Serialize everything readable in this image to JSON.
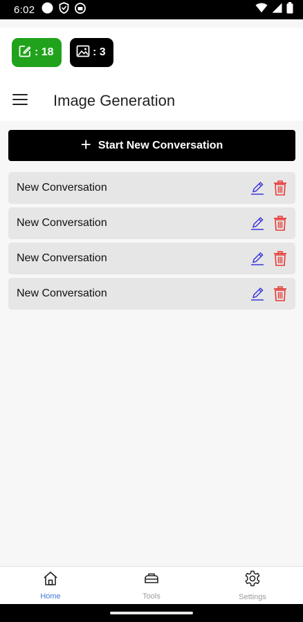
{
  "status_bar": {
    "time": "6:02"
  },
  "header": {
    "badges": [
      {
        "icon": "edit-square-icon",
        "text": ": 18",
        "color": "#21a21c"
      },
      {
        "icon": "image-icon",
        "text": ": 3",
        "color": "#000000"
      }
    ],
    "title": "Image Generation"
  },
  "main": {
    "new_conversation_label": "Start New Conversation",
    "conversations": [
      {
        "label": "New Conversation"
      },
      {
        "label": "New Conversation"
      },
      {
        "label": "New Conversation"
      },
      {
        "label": "New Conversation"
      }
    ]
  },
  "bottom_nav": {
    "items": [
      {
        "label": "Home",
        "icon": "home-icon",
        "active": true
      },
      {
        "label": "Tools",
        "icon": "toolbox-icon",
        "active": false
      },
      {
        "label": "Settings",
        "icon": "gear-icon",
        "active": false
      }
    ]
  },
  "colors": {
    "accent_active": "#3c78d8",
    "edit_icon": "#3a36d8",
    "delete_icon": "#e53935",
    "badge_green": "#21a21c"
  }
}
